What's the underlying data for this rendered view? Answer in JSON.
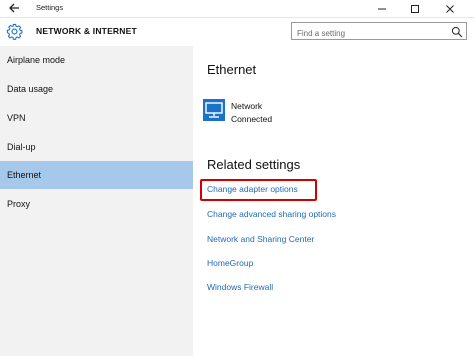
{
  "window": {
    "title": "Settings",
    "controls": [
      "minimize",
      "maximize",
      "close"
    ]
  },
  "header": {
    "title": "NETWORK & INTERNET",
    "search_placeholder": "Find a setting"
  },
  "sidebar": {
    "items": [
      {
        "label": "Airplane mode",
        "active": false
      },
      {
        "label": "Data usage",
        "active": false
      },
      {
        "label": "VPN",
        "active": false
      },
      {
        "label": "Dial-up",
        "active": false
      },
      {
        "label": "Ethernet",
        "active": true
      },
      {
        "label": "Proxy",
        "active": false
      }
    ]
  },
  "main": {
    "heading": "Ethernet",
    "network": {
      "name": "Network",
      "status": "Connected"
    },
    "related_heading": "Related settings",
    "links": [
      "Change adapter options",
      "Change advanced sharing options",
      "Network and Sharing Center",
      "HomeGroup",
      "Windows Firewall"
    ]
  },
  "colors": {
    "sidebar_bg": "#f2f2f2",
    "active_item_bg": "#a6c8ea",
    "link": "#1f6bb5",
    "accent_icon": "#1a73c9",
    "highlight_box": "#d40000"
  },
  "icons": {
    "back": "back-arrow-icon",
    "settings": "gear-icon",
    "search": "search-icon",
    "network": "ethernet-monitor-icon"
  }
}
